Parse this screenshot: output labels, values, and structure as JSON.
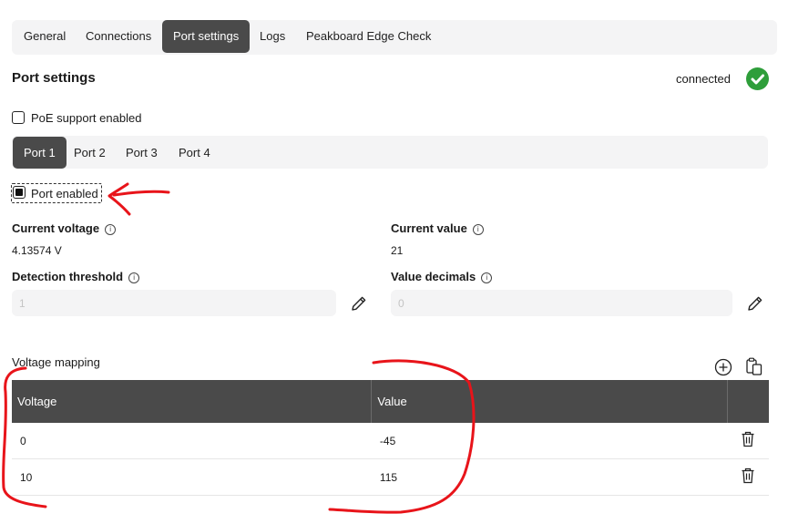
{
  "tabs": [
    "General",
    "Connections",
    "Port settings",
    "Logs",
    "Peakboard Edge Check"
  ],
  "active_tab": "Port settings",
  "page_title": "Port settings",
  "status": {
    "text": "connected",
    "color": "#2e9e3a"
  },
  "poe": {
    "label": "PoE support enabled",
    "checked": false
  },
  "ports": [
    "Port 1",
    "Port 2",
    "Port 3",
    "Port 4"
  ],
  "active_port": "Port 1",
  "port_enabled": {
    "label": "Port enabled",
    "checked": true
  },
  "current_voltage": {
    "label": "Current voltage",
    "value": "4.13574 V"
  },
  "current_value": {
    "label": "Current value",
    "value": "21"
  },
  "detection_threshold": {
    "label": "Detection threshold",
    "placeholder": "1"
  },
  "value_decimals": {
    "label": "Value decimals",
    "placeholder": "0"
  },
  "voltage_mapping": {
    "title": "Voltage mapping",
    "columns": [
      "Voltage",
      "Value"
    ],
    "rows": [
      {
        "voltage": "0",
        "value": "-45"
      },
      {
        "voltage": "10",
        "value": "115"
      }
    ]
  },
  "icons": {
    "info": "info-icon",
    "edit": "pencil-icon",
    "add": "plus-circle-icon",
    "paste": "clipboard-icon",
    "delete": "trash-icon",
    "status": "check-circle-icon"
  },
  "colors": {
    "accent": "#4a4a4a",
    "annotation": "#e8141a"
  }
}
